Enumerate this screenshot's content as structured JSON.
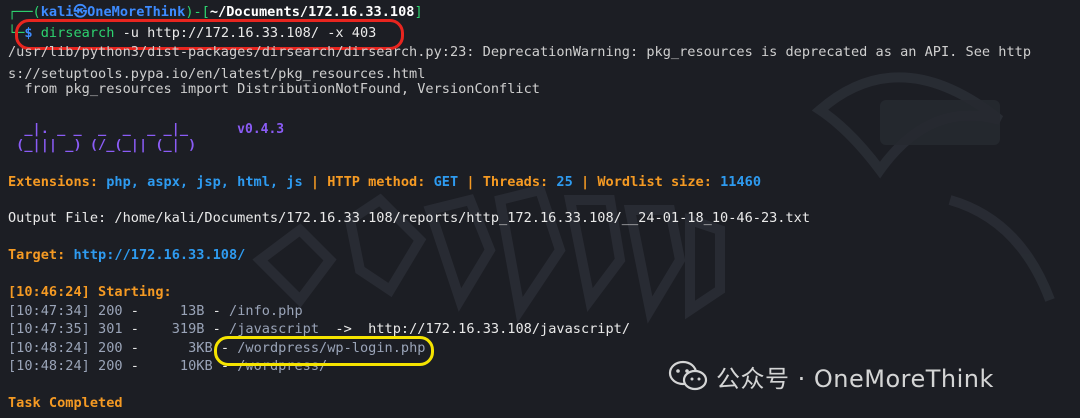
{
  "prompt": {
    "user": "kali",
    "at_symbol": "㉿",
    "host": "OneMoreThink",
    "cwd": "~/Documents/172.16.33.108",
    "dollar": "$"
  },
  "command": {
    "program": "dirsearch",
    "args": "-u http://172.16.33.108/ -x 403"
  },
  "warning": {
    "line1": "/usr/lib/python3/dist-packages/dirsearch/dirsearch.py:23: DeprecationWarning: pkg_resources is deprecated as an API. See http",
    "line2": "s://setuptools.pypa.io/en/latest/pkg_resources.html",
    "line3": "  from pkg_resources import DistributionNotFound, VersionConflict"
  },
  "banner": {
    "art1": "  _|. _ _  _  _  _ _|_",
    "art2": " (_||| _) (/_(_|| (_| )",
    "version": "v0.4.3"
  },
  "config": {
    "ext_label": "Extensions:",
    "ext_value": "php, aspx, jsp, html, js",
    "sep": "|",
    "method_label": "HTTP method:",
    "method_value": "GET",
    "threads_label": "Threads:",
    "threads_value": "25",
    "wordlist_label": "Wordlist size:",
    "wordlist_value": "11460"
  },
  "output_file": "Output File: /home/kali/Documents/172.16.33.108/reports/http_172.16.33.108/__24-01-18_10-46-23.txt",
  "target": {
    "label": "Target:",
    "url": "http://172.16.33.108/"
  },
  "starting": "[10:46:24] Starting:",
  "results": [
    {
      "time": "[10:47:34]",
      "status": "200",
      "size": "   13B",
      "path": "/info.php",
      "redirect": ""
    },
    {
      "time": "[10:47:35]",
      "status": "301",
      "size": "  319B",
      "path": "/javascript",
      "redirect": "  ->  http://172.16.33.108/javascript/"
    },
    {
      "time": "[10:48:24]",
      "status": "200",
      "size": "    3KB",
      "path": "/wordpress/wp-login.php",
      "redirect": ""
    },
    {
      "time": "[10:48:24]",
      "status": "200",
      "size": "   10KB",
      "path": "/wordpress/",
      "redirect": ""
    }
  ],
  "completed": "Task Completed",
  "watermark": "公众号 · OneMoreThink",
  "colors": {
    "highlight_command": "#e8251f",
    "highlight_login": "#f5e400"
  }
}
